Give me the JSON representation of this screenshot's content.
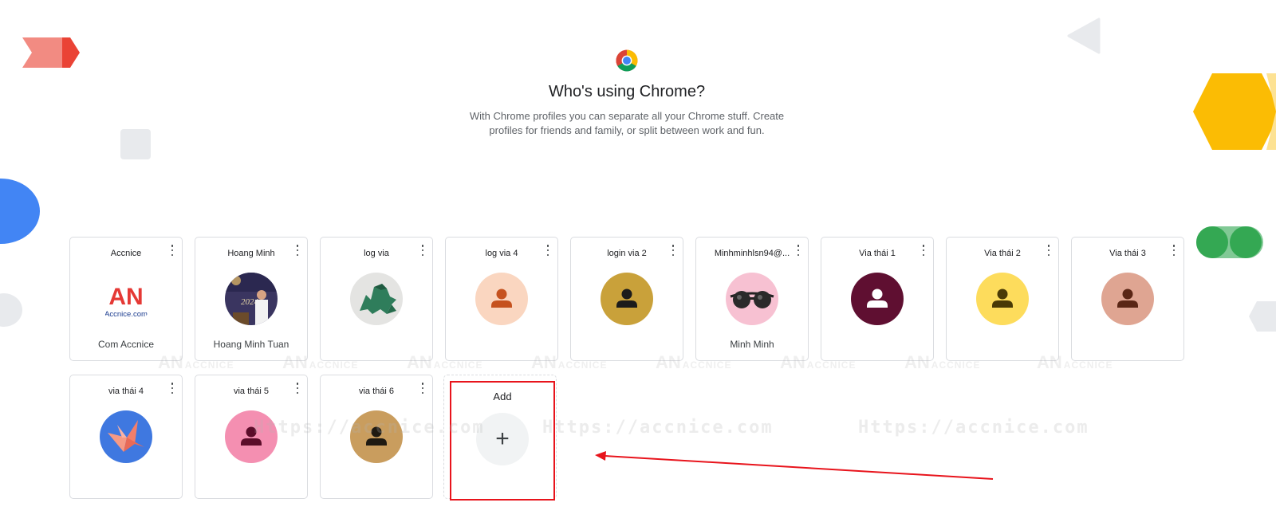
{
  "header": {
    "title": "Who's using Chrome?",
    "subtitle": "With Chrome profiles you can separate all your Chrome stuff. Create profiles for friends and family, or split between work and fun."
  },
  "profiles": [
    {
      "name": "Accnice",
      "subname": "Com Accnice",
      "avatar": "accnice-logo",
      "avatar_text": "Accnice.com"
    },
    {
      "name": "Hoang Minh",
      "subname": "Hoang Minh Tuan",
      "avatar": "photo-avatar",
      "avatar_text": "2024"
    },
    {
      "name": "log via",
      "subname": "",
      "avatar": "dinosaur-avatar"
    },
    {
      "name": "log via 4",
      "subname": "",
      "avatar": "person-icon",
      "bg": "#fad6c0",
      "fg": "#c5521f"
    },
    {
      "name": "login via 2",
      "subname": "",
      "avatar": "person-icon",
      "bg": "#c9a13a",
      "fg": "#1b1b1b"
    },
    {
      "name": "Minhminhlsn94@...",
      "subname": "Minh Minh",
      "avatar": "sunglasses-avatar"
    },
    {
      "name": "Via thái 1",
      "subname": "",
      "avatar": "person-icon",
      "bg": "#5f0f31",
      "fg": "#ffffff"
    },
    {
      "name": "Via thái 2",
      "subname": "",
      "avatar": "person-icon",
      "bg": "#fddc5c",
      "fg": "#4a3a06"
    },
    {
      "name": "Via thái 3",
      "subname": "",
      "avatar": "person-icon",
      "bg": "#dfa592",
      "fg": "#5a2615"
    },
    {
      "name": "via thái 4",
      "subname": "",
      "avatar": "origami-bird-avatar"
    },
    {
      "name": "via thái 5",
      "subname": "",
      "avatar": "person-icon",
      "bg": "#f48fb1",
      "fg": "#5c0d2a"
    },
    {
      "name": "via thái 6",
      "subname": "",
      "avatar": "person-icon",
      "bg": "#c99d5e",
      "fg": "#1f1a12"
    }
  ],
  "add_card": {
    "label": "Add",
    "icon": "+"
  },
  "watermarks": {
    "url": "Https://accnice.com",
    "logo_mark": "AN",
    "logo_word": "ACCNICE"
  },
  "colors": {
    "annotation": "#e8141c",
    "card_border": "#dadce0"
  }
}
